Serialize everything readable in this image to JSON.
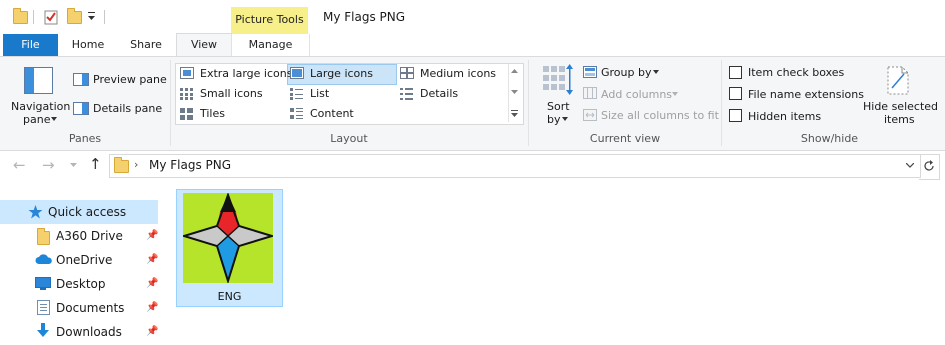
{
  "window": {
    "title": "My Flags PNG"
  },
  "contextual_tab": {
    "label": "Picture Tools"
  },
  "tabs": {
    "file": "File",
    "home": "Home",
    "share": "Share",
    "view": "View",
    "manage": "Manage"
  },
  "ribbon": {
    "panes": {
      "navigation_pane": "Navigation",
      "navigation_pane_2": "pane",
      "preview_pane": "Preview pane",
      "details_pane": "Details pane",
      "group_label": "Panes"
    },
    "layout": {
      "extra_large_icons": "Extra large icons",
      "large_icons": "Large icons",
      "medium_icons": "Medium icons",
      "small_icons": "Small icons",
      "list": "List",
      "details": "Details",
      "tiles": "Tiles",
      "content": "Content",
      "group_label": "Layout",
      "selected": "Large icons"
    },
    "current_view": {
      "sort_by": "Sort",
      "sort_by_2": "by",
      "group_by": "Group by",
      "add_columns": "Add columns",
      "size_all_columns": "Size all columns to fit",
      "group_label": "Current view"
    },
    "show_hide": {
      "item_check_boxes": "Item check boxes",
      "file_name_extensions": "File name extensions",
      "hidden_items": "Hidden items",
      "hide_selected": "Hide selected",
      "hide_selected_2": "items",
      "group_label": "Show/hide"
    }
  },
  "address": {
    "path": "My Flags PNG"
  },
  "nav_pane": {
    "items": [
      {
        "label": "Quick access",
        "icon": "star-icon",
        "pinned": false,
        "selected": true
      },
      {
        "label": "A360 Drive",
        "icon": "folder-icon",
        "pinned": true
      },
      {
        "label": "OneDrive",
        "icon": "cloud-icon",
        "pinned": true
      },
      {
        "label": "Desktop",
        "icon": "desktop-icon",
        "pinned": true
      },
      {
        "label": "Documents",
        "icon": "documents-icon",
        "pinned": true
      },
      {
        "label": "Downloads",
        "icon": "download-icon",
        "pinned": true
      }
    ]
  },
  "files": [
    {
      "name": "ENG",
      "selected": true
    }
  ],
  "colors": {
    "file_tab": "#1979ca",
    "context_tab": "#f6ef8a",
    "selection": "#cce8ff",
    "thumb_bg": "#b6e42b",
    "star_red": "#e8262a",
    "star_blue": "#1f9be3",
    "star_gray": "#c9c9c9"
  }
}
